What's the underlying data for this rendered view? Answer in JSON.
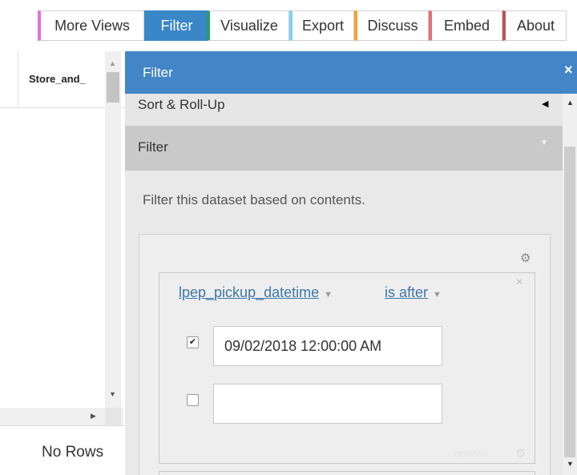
{
  "toolbar": {
    "buttons": [
      {
        "label": "More Views",
        "accent": "#e46ee0"
      },
      {
        "label": "Filter",
        "accent": "#3a87c8",
        "active": true
      },
      {
        "label": "Visualize",
        "accent": "#2a9d6a"
      },
      {
        "label": "Export",
        "accent": "#7fd3ef"
      },
      {
        "label": "Discuss",
        "accent": "#f2a334"
      },
      {
        "label": "Embed",
        "accent": "#ea6b74"
      },
      {
        "label": "About",
        "accent": "#c0505c"
      }
    ]
  },
  "grid": {
    "column_title": "Store_and_",
    "footer": "No Rows"
  },
  "panel": {
    "title": "Filter",
    "close_glyph": "×",
    "sections": {
      "sort": "Sort & Roll-Up",
      "filter": "Filter"
    },
    "description": "Filter this dataset based on contents.",
    "condition": {
      "column": "lpep_pickup_datetime",
      "operator": "is after",
      "values": [
        {
          "checked": true,
          "value": "09/02/2018 12:00:00 AM"
        },
        {
          "checked": false,
          "value": ""
        }
      ],
      "options_label": "options"
    }
  },
  "colors": {
    "panel_header": "#4286c8",
    "link": "#3d77a8",
    "active_button": "#3a87c8"
  }
}
